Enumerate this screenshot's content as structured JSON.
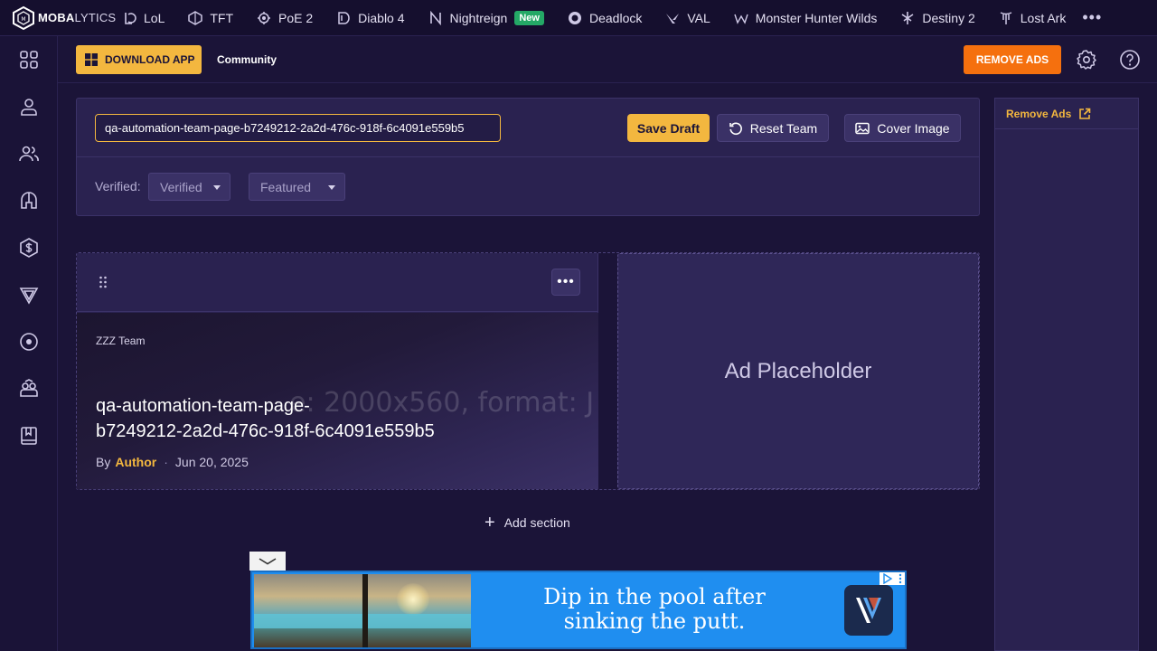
{
  "brand": {
    "name_bold": "MOBA",
    "name_light": "LYTICS"
  },
  "top_nav": {
    "games": [
      {
        "label": "LoL",
        "icon": "lol-icon"
      },
      {
        "label": "TFT",
        "icon": "tft-icon"
      },
      {
        "label": "PoE 2",
        "icon": "poe2-icon"
      },
      {
        "label": "Diablo 4",
        "icon": "diablo4-icon"
      },
      {
        "label": "Nightreign",
        "icon": "nightreign-icon",
        "badge": "New"
      },
      {
        "label": "Deadlock",
        "icon": "deadlock-icon"
      },
      {
        "label": "VAL",
        "icon": "valorant-icon"
      },
      {
        "label": "Monster Hunter Wilds",
        "icon": "monster-hunter-icon"
      },
      {
        "label": "Destiny 2",
        "icon": "destiny2-icon"
      },
      {
        "label": "Lost Ark",
        "icon": "lost-ark-icon"
      }
    ],
    "more": "•••"
  },
  "subheader": {
    "download_label": "DOWNLOAD APP",
    "community_label": "Community",
    "remove_ads_label": "REMOVE ADS"
  },
  "editor": {
    "title_value": "qa-automation-team-page-b7249212-2a2d-476c-918f-6c4091e559b5",
    "save_draft_label": "Save Draft",
    "reset_team_label": "Reset Team",
    "cover_image_label": "Cover Image",
    "verified_label": "Verified:",
    "verified_value": "Verified",
    "featured_value": "Featured"
  },
  "card": {
    "kicker": "ZZZ Team",
    "watermark": "e: 2000x560, format: J",
    "title_line1": "qa-automation-team-page-",
    "title_line2": "b7249212-2a2d-476c-918f-6c4091e559b5",
    "by_label": "By",
    "author": "Author",
    "separator": "·",
    "date": "Jun 20, 2025",
    "menu_label": "•••"
  },
  "ad_placeholder_label": "Ad Placeholder",
  "add_section": {
    "plus": "+",
    "label": "Add section"
  },
  "right_sidebar": {
    "remove_ads_label": "Remove Ads"
  },
  "bottom_ad": {
    "line1": "Dip in the pool after",
    "line2": "sinking the putt."
  },
  "colors": {
    "background": "#1b1438",
    "panel": "#2a2250",
    "accent_yellow": "#f3b73f",
    "accent_orange": "#f5700e",
    "new_badge": "#24a866"
  }
}
